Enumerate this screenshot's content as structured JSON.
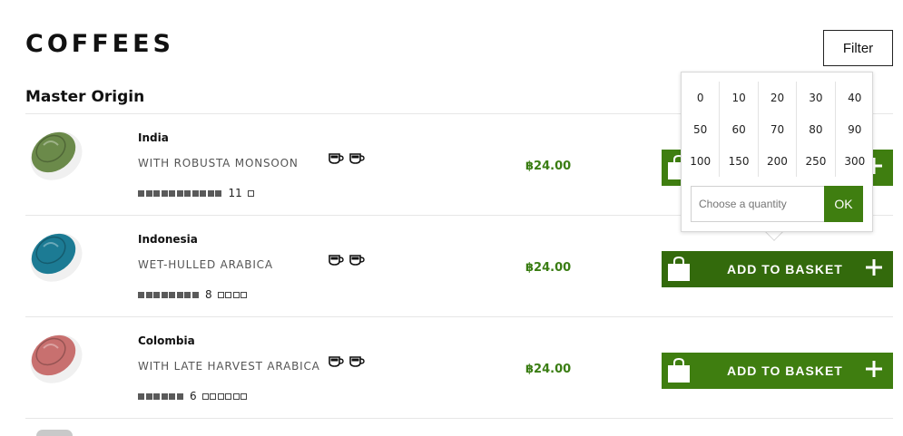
{
  "header": {
    "title": "COFFEES",
    "filter_label": "Filter"
  },
  "section": {
    "title": "Master Origin"
  },
  "products": [
    {
      "name": "India",
      "description": "WITH ROBUSTA MONSOON",
      "intensity": 11,
      "intensity_max": 12,
      "price": "฿24.00",
      "basket_label": "ADD TO BASKET",
      "capsule_color": "#6b8a4a"
    },
    {
      "name": "Indonesia",
      "description": "WET-HULLED ARABICA",
      "intensity": 8,
      "intensity_max": 12,
      "price": "฿24.00",
      "basket_label": "ADD TO BASKET",
      "capsule_color": "#1c7b94"
    },
    {
      "name": "Colombia",
      "description": "WITH LATE HARVEST ARABICA",
      "intensity": 6,
      "intensity_max": 12,
      "price": "฿24.00",
      "basket_label": "ADD TO BASKET",
      "capsule_color": "#c8706f"
    }
  ],
  "quantity_popover": {
    "options": [
      "0",
      "10",
      "20",
      "30",
      "40",
      "50",
      "60",
      "70",
      "80",
      "90",
      "100",
      "150",
      "200",
      "250",
      "300"
    ],
    "placeholder": "Choose a quantity",
    "ok_label": "OK"
  },
  "colors": {
    "accent_green": "#3f7e10",
    "price_green": "#3a7d13"
  },
  "icons": {
    "cup": "espresso-cup-icon",
    "bag": "shopping-bag-icon",
    "plus": "plus-icon"
  }
}
